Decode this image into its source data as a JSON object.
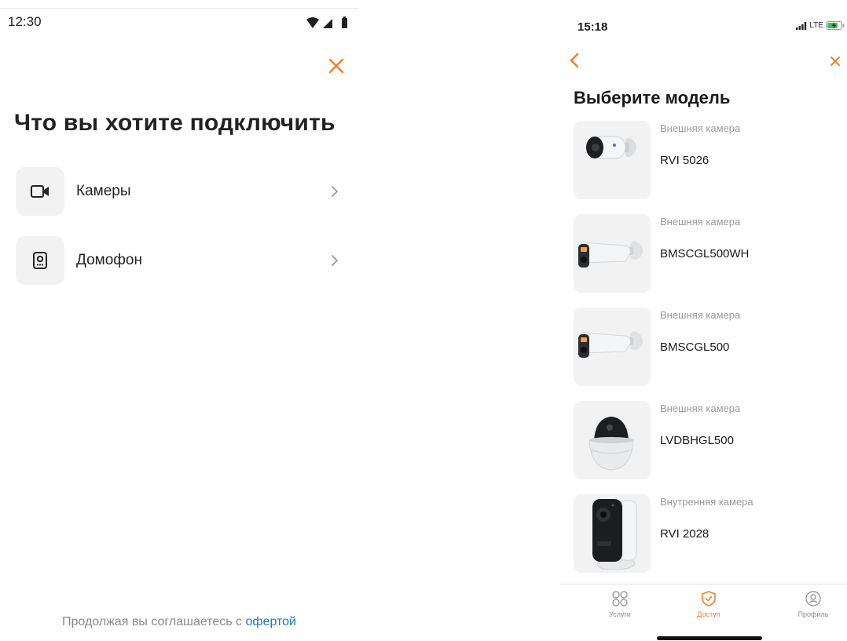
{
  "left": {
    "status_time": "12:30",
    "title": "Что вы хотите подключить",
    "options": [
      {
        "label": "Камеры",
        "icon": "camera-icon"
      },
      {
        "label": "Домофон",
        "icon": "intercom-icon"
      }
    ],
    "legal_text": "Продолжая вы соглашаетесь с",
    "legal_link": "офертой"
  },
  "right": {
    "status_time": "15:18",
    "network": "LTE",
    "title": "Выберите модель",
    "models": [
      {
        "category": "Внешняя камера",
        "name": "RVI 5026"
      },
      {
        "category": "Внешняя камера",
        "name": "BMSCGL500WH"
      },
      {
        "category": "Внешняя камера",
        "name": "BMSCGL500"
      },
      {
        "category": "Внешняя камера",
        "name": "LVDBHGL500"
      },
      {
        "category": "Внутренняя камера",
        "name": "RVI 2028"
      }
    ],
    "tabs": [
      {
        "label": "Услуги",
        "icon": "grid-icon",
        "active": false
      },
      {
        "label": "Доступ",
        "icon": "shield-check-icon",
        "active": true
      },
      {
        "label": "Профиль",
        "icon": "profile-icon",
        "active": false
      }
    ]
  },
  "colors": {
    "accent": "#f57c2b",
    "link": "#1976d2",
    "tile_bg": "#f2f2f2",
    "muted_text": "#9a9a9a"
  }
}
